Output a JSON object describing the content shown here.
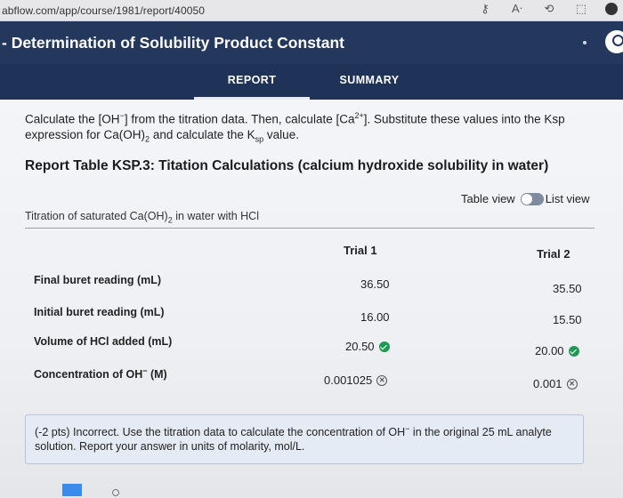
{
  "browser": {
    "url": "abflow.com/app/course/1981/report/40050",
    "icons": [
      "key-icon",
      "text-size-icon",
      "profile-sync-icon",
      "extension-icon",
      "menu-icon"
    ]
  },
  "header": {
    "title": "- Determination of Solubility Product Constant"
  },
  "tabs": [
    {
      "label": "REPORT",
      "active": true
    },
    {
      "label": "SUMMARY",
      "active": false
    }
  ],
  "instructions": {
    "line1_a": "Calculate the [OH",
    "line1_sup1": "−",
    "line1_b": "] from the titration data. Then, calculate [Ca",
    "line1_sup2": "2+",
    "line1_c": "]. Substitute these values into the Ksp",
    "line2_a": "expression for Ca(OH)",
    "line2_sub": "2",
    "line2_b": " and calculate the K",
    "line2_sub2": "sp",
    "line2_c": " value."
  },
  "report_table": {
    "heading": "Report Table KSP.3: Titation Calculations (calcium hydroxide solubility in water)",
    "view_toggle": {
      "table_view": "Table view",
      "list_view": "List view"
    },
    "caption_a": "Titration of saturated Ca(OH)",
    "caption_sub": "2",
    "caption_b": " in water with HCl",
    "columns": [
      "Trial 1",
      "Trial 2"
    ],
    "rows": [
      {
        "label": "Final buret reading (mL)",
        "trial1": "36.50",
        "trial2": "35.50"
      },
      {
        "label": "Initial buret reading (mL)",
        "trial1": "16.00",
        "trial2": "15.50"
      },
      {
        "label": "Volume of HCl added (mL)",
        "trial1": "20.50",
        "trial2": "20.00"
      },
      {
        "label_a": "Concentration of OH",
        "label_sup": "−",
        "label_b": " (M)",
        "trial1": "0.001025",
        "trial2": "0.001"
      }
    ]
  },
  "feedback": {
    "text_a": "(-2 pts) Incorrect. Use the titration data to calculate the concentration of OH",
    "text_sup": "−",
    "text_b": " in the original 25 mL analyte solution. Report your answer in units of molarity, mol/L."
  },
  "colors": {
    "header_bg": "#24385e",
    "tab_bg": "#1f3358",
    "correct": "#1f9a52",
    "feedback_bg": "#e4ebf5"
  }
}
